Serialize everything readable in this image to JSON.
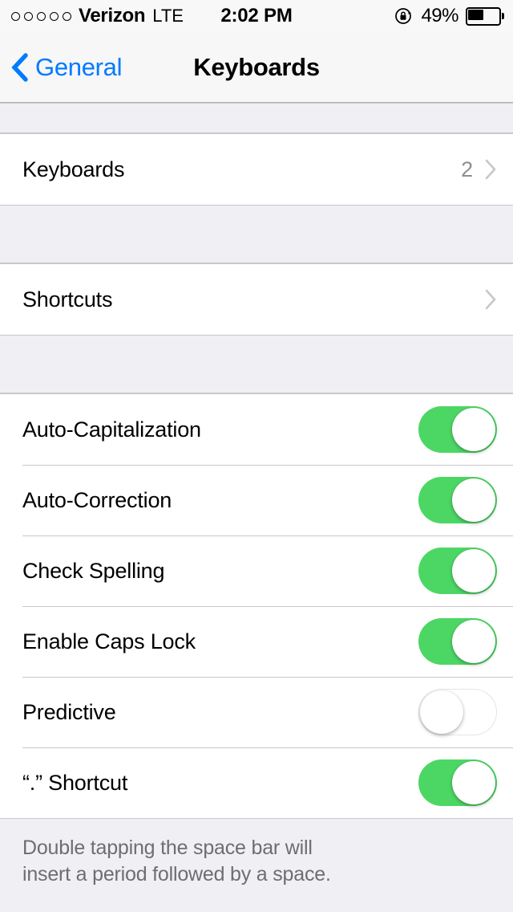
{
  "status_bar": {
    "signal_dots": 5,
    "carrier": "Verizon",
    "radio": "LTE",
    "time": "2:02 PM",
    "rotation_lock_icon": "rotation-lock-icon",
    "battery_percent": "49%",
    "battery_level": 49
  },
  "nav": {
    "back_label": "General",
    "back_icon": "chevron-left-icon",
    "title": "Keyboards"
  },
  "sections": [
    {
      "rows": [
        {
          "label": "Keyboards",
          "value": "2",
          "type": "disclosure",
          "icon": "chevron-right-icon"
        }
      ]
    },
    {
      "rows": [
        {
          "label": "Shortcuts",
          "value": "",
          "type": "disclosure",
          "icon": "chevron-right-icon"
        }
      ]
    },
    {
      "rows": [
        {
          "label": "Auto-Capitalization",
          "type": "switch",
          "on": true
        },
        {
          "label": "Auto-Correction",
          "type": "switch",
          "on": true
        },
        {
          "label": "Check Spelling",
          "type": "switch",
          "on": true
        },
        {
          "label": "Enable Caps Lock",
          "type": "switch",
          "on": true
        },
        {
          "label": "Predictive",
          "type": "switch",
          "on": false
        },
        {
          "label": "“.” Shortcut",
          "type": "switch",
          "on": true
        }
      ],
      "footer": [
        "Double tapping the space bar will",
        "insert a period followed by a space."
      ]
    }
  ],
  "colors": {
    "accent_blue": "#007AFF",
    "switch_on_green": "#4CD764",
    "background_gray": "#EFEFF4",
    "separator": "#C8C7CC",
    "secondary_text": "#8E8E93",
    "footer_text": "#6D6D72"
  }
}
